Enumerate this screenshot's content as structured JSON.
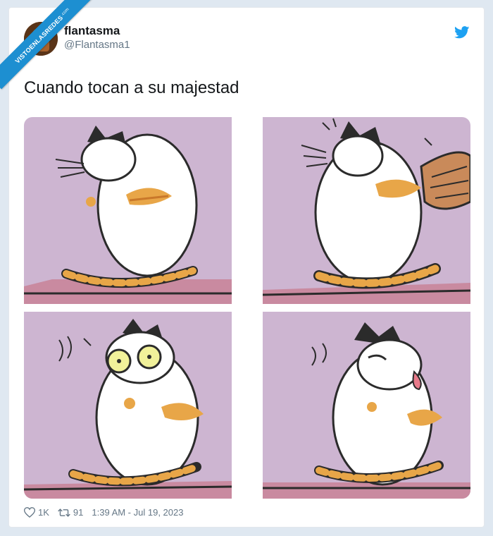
{
  "watermark": {
    "text": "VISTOENLASREDES",
    "suffix": ".com"
  },
  "tweet": {
    "author_name": "flantasma",
    "author_handle": "@Flantasma1",
    "text": "Cuando tocan a su majestad",
    "likes": "1K",
    "retweets": "91",
    "timestamp": "1:39 AM - Jul 19, 2023"
  },
  "icons": {
    "bird": "twitter-bird-icon",
    "like": "heart-icon",
    "retweet": "retweet-icon"
  },
  "colors": {
    "twitter_blue": "#1da1f2",
    "panel_background": "#cdb5d1",
    "cat_orange": "#e8a648",
    "text_dark": "#14171a",
    "text_gray": "#657786"
  },
  "media": {
    "panels": [
      "cat-sitting",
      "cat-petted",
      "cat-startled",
      "cat-licking"
    ]
  }
}
